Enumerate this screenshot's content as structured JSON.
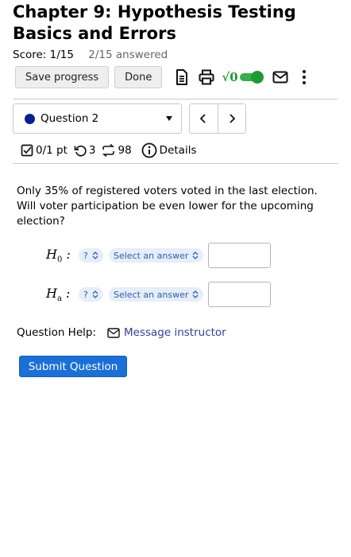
{
  "page": {
    "title": "Chapter 9: Hypothesis Testing Basics and Errors"
  },
  "score": {
    "label": "Score: 1/15",
    "answered": "2/15 answered"
  },
  "toolbar": {
    "save_label": "Save progress",
    "done_label": "Done",
    "icons": [
      "document-icon",
      "print-icon",
      "math-toggle-icon",
      "mail-icon",
      "more-icon"
    ],
    "math_label": "√0",
    "math_toggle_on": true
  },
  "question_nav": {
    "selected": "Question 2",
    "dot_color": "#0a1f8f",
    "prev_icon": "chevron-left-icon",
    "next_icon": "chevron-right-icon"
  },
  "meta": {
    "points": "0/1 pt",
    "retries": "3",
    "attempts": "98",
    "details": "Details"
  },
  "question": {
    "text": "Only 35% of registered voters voted in the last election. Will voter participation be even lower for the upcoming election?"
  },
  "hypotheses": [
    {
      "base": "H",
      "sub": "0",
      "colon": ":",
      "symbol_label": "?",
      "answer_label": "Select an answer",
      "value": ""
    },
    {
      "base": "H",
      "sub": "a",
      "colon": ":",
      "symbol_label": "?",
      "answer_label": "Select an answer",
      "value": ""
    }
  ],
  "help": {
    "label": "Question Help:",
    "message_label": "Message instructor"
  },
  "submit_label": "Submit Question",
  "colors": {
    "accent": "#1a6fd8",
    "toggle": "#35b04a",
    "link": "#2c3f9c",
    "pill_bg": "#e6eef9"
  }
}
